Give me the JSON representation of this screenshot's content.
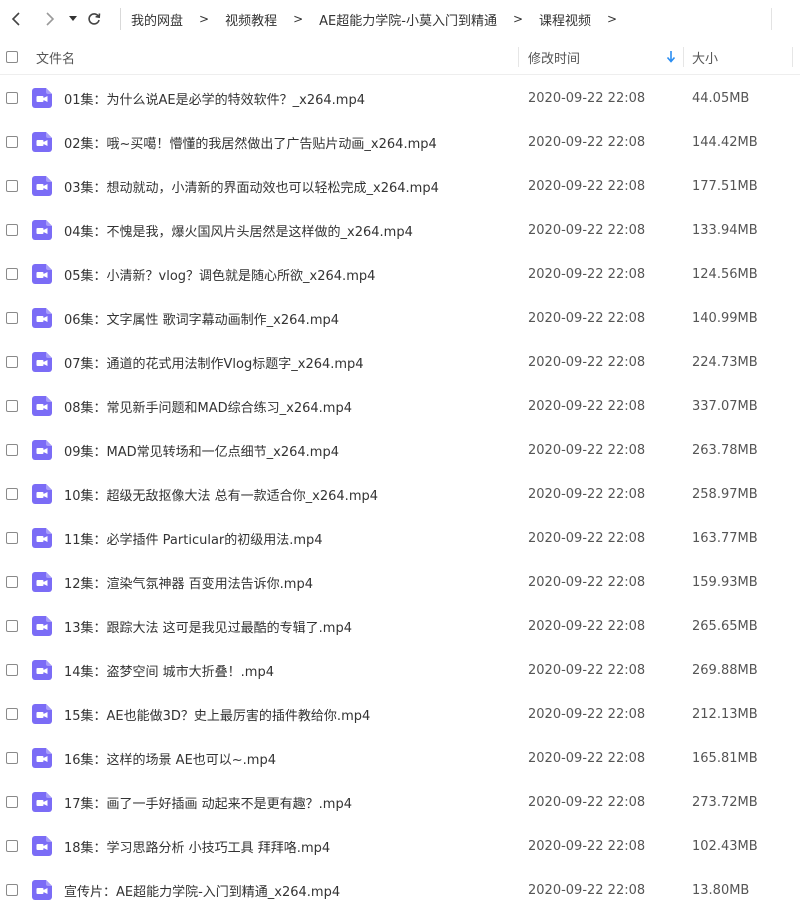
{
  "toolbar": {
    "back_icon": "chevron-left-icon",
    "forward_icon": "chevron-right-icon",
    "dropdown_icon": "caret-down-icon",
    "refresh_icon": "refresh-icon",
    "breadcrumb": [
      "我的网盘",
      "视频教程",
      "AE超能力学院-小莫入门到精通",
      "课程视频"
    ],
    "separator": ">"
  },
  "columns": {
    "name": "文件名",
    "modified": "修改时间",
    "size": "大小"
  },
  "colors": {
    "video_icon": "#7b6cf6",
    "sort_arrow": "#2b8ef2"
  },
  "files": [
    {
      "name": "01集：为什么说AE是必学的特效软件？_x264.mp4",
      "modified": "2020-09-22 22:08",
      "size": "44.05MB"
    },
    {
      "name": "02集：哦~买噶！懵懂的我居然做出了广告贴片动画_x264.mp4",
      "modified": "2020-09-22 22:08",
      "size": "144.42MB"
    },
    {
      "name": "03集：想动就动，小清新的界面动效也可以轻松完成_x264.mp4",
      "modified": "2020-09-22 22:08",
      "size": "177.51MB"
    },
    {
      "name": "04集：不愧是我，爆火国风片头居然是这样做的_x264.mp4",
      "modified": "2020-09-22 22:08",
      "size": "133.94MB"
    },
    {
      "name": "05集：小清新？vlog？调色就是随心所欲_x264.mp4",
      "modified": "2020-09-22 22:08",
      "size": "124.56MB"
    },
    {
      "name": "06集：文字属性 歌词字幕动画制作_x264.mp4",
      "modified": "2020-09-22 22:08",
      "size": "140.99MB"
    },
    {
      "name": "07集：通道的花式用法制作Vlog标题字_x264.mp4",
      "modified": "2020-09-22 22:08",
      "size": "224.73MB"
    },
    {
      "name": "08集：常见新手问题和MAD综合练习_x264.mp4",
      "modified": "2020-09-22 22:08",
      "size": "337.07MB"
    },
    {
      "name": "09集：MAD常见转场和一亿点细节_x264.mp4",
      "modified": "2020-09-22 22:08",
      "size": "263.78MB"
    },
    {
      "name": "10集：超级无敌抠像大法 总有一款适合你_x264.mp4",
      "modified": "2020-09-22 22:08",
      "size": "258.97MB"
    },
    {
      "name": "11集：必学插件 Particular的初级用法.mp4",
      "modified": "2020-09-22 22:08",
      "size": "163.77MB"
    },
    {
      "name": "12集：渲染气氛神器 百变用法告诉你.mp4",
      "modified": "2020-09-22 22:08",
      "size": "159.93MB"
    },
    {
      "name": "13集：跟踪大法 这可是我见过最酷的专辑了.mp4",
      "modified": "2020-09-22 22:08",
      "size": "265.65MB"
    },
    {
      "name": "14集：盗梦空间 城市大折叠！.mp4",
      "modified": "2020-09-22 22:08",
      "size": "269.88MB"
    },
    {
      "name": "15集：AE也能做3D？史上最厉害的插件教给你.mp4",
      "modified": "2020-09-22 22:08",
      "size": "212.13MB"
    },
    {
      "name": "16集：这样的场景 AE也可以~.mp4",
      "modified": "2020-09-22 22:08",
      "size": "165.81MB"
    },
    {
      "name": "17集：画了一手好插画 动起来不是更有趣？.mp4",
      "modified": "2020-09-22 22:08",
      "size": "273.72MB"
    },
    {
      "name": "18集：学习思路分析 小技巧工具 拜拜咯.mp4",
      "modified": "2020-09-22 22:08",
      "size": "102.43MB"
    },
    {
      "name": "宣传片：AE超能力学院-入门到精通_x264.mp4",
      "modified": "2020-09-22 22:08",
      "size": "13.80MB"
    }
  ]
}
